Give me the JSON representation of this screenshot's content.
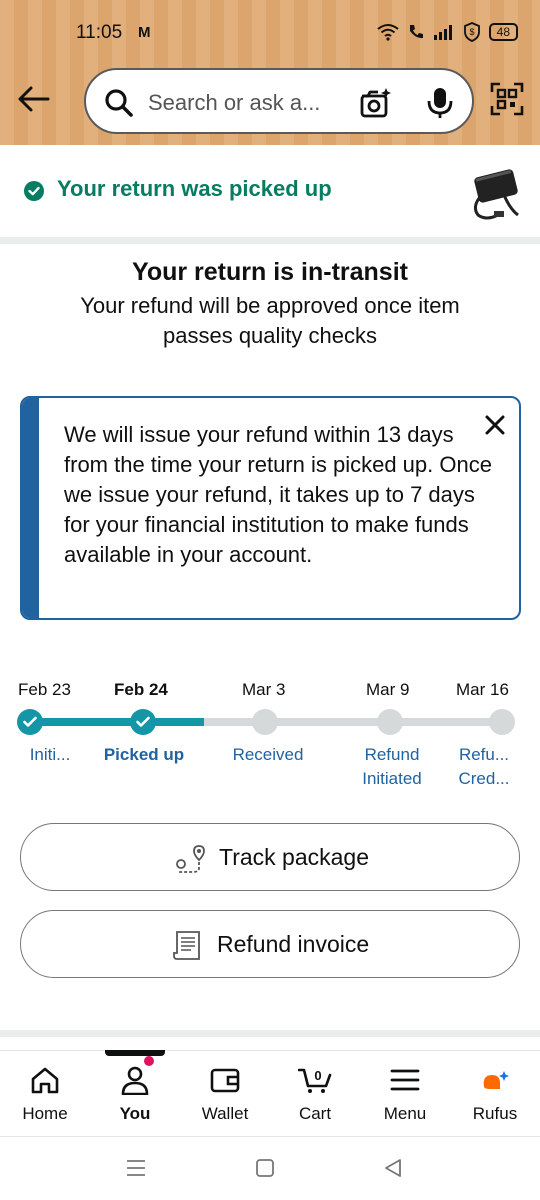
{
  "status_bar": {
    "time": "11:05",
    "carrier_mark": "M",
    "battery": "48"
  },
  "search": {
    "placeholder": "Search or ask a..."
  },
  "banner": {
    "text": "Your return was picked up",
    "accent_color": "#067d62"
  },
  "status": {
    "title": "Your return is in-transit",
    "subtitle": "Your refund will be approved once item passes quality checks"
  },
  "info": {
    "message": "We will issue your refund within 13 days from the time your return is picked up. Once we issue your refund, it takes up to 7 days for your financial institution to make funds available in your account.",
    "accent_color": "#2162a1"
  },
  "timeline": {
    "progress_color": "#1596a6",
    "steps": [
      {
        "date": "Feb 23",
        "label": "Initi...",
        "done": true
      },
      {
        "date": "Feb 24",
        "label": "Picked up",
        "done": true,
        "current": true
      },
      {
        "date": "Mar 3",
        "label": "Received",
        "done": false
      },
      {
        "date": "Mar 9",
        "label": "Refund Initiated",
        "done": false
      },
      {
        "date": "Mar 16",
        "label": "Refu... Cred...",
        "done": false
      }
    ]
  },
  "actions": {
    "track_label": "Track package",
    "invoice_label": "Refund invoice"
  },
  "bottom_nav": {
    "items": [
      {
        "label": "Home",
        "icon": "home-icon"
      },
      {
        "label": "You",
        "icon": "user-icon",
        "active": true
      },
      {
        "label": "Wallet",
        "icon": "wallet-icon"
      },
      {
        "label": "Cart",
        "icon": "cart-icon",
        "count": "0"
      },
      {
        "label": "Menu",
        "icon": "menu-icon"
      },
      {
        "label": "Rufus",
        "icon": "rufus-icon"
      }
    ]
  }
}
